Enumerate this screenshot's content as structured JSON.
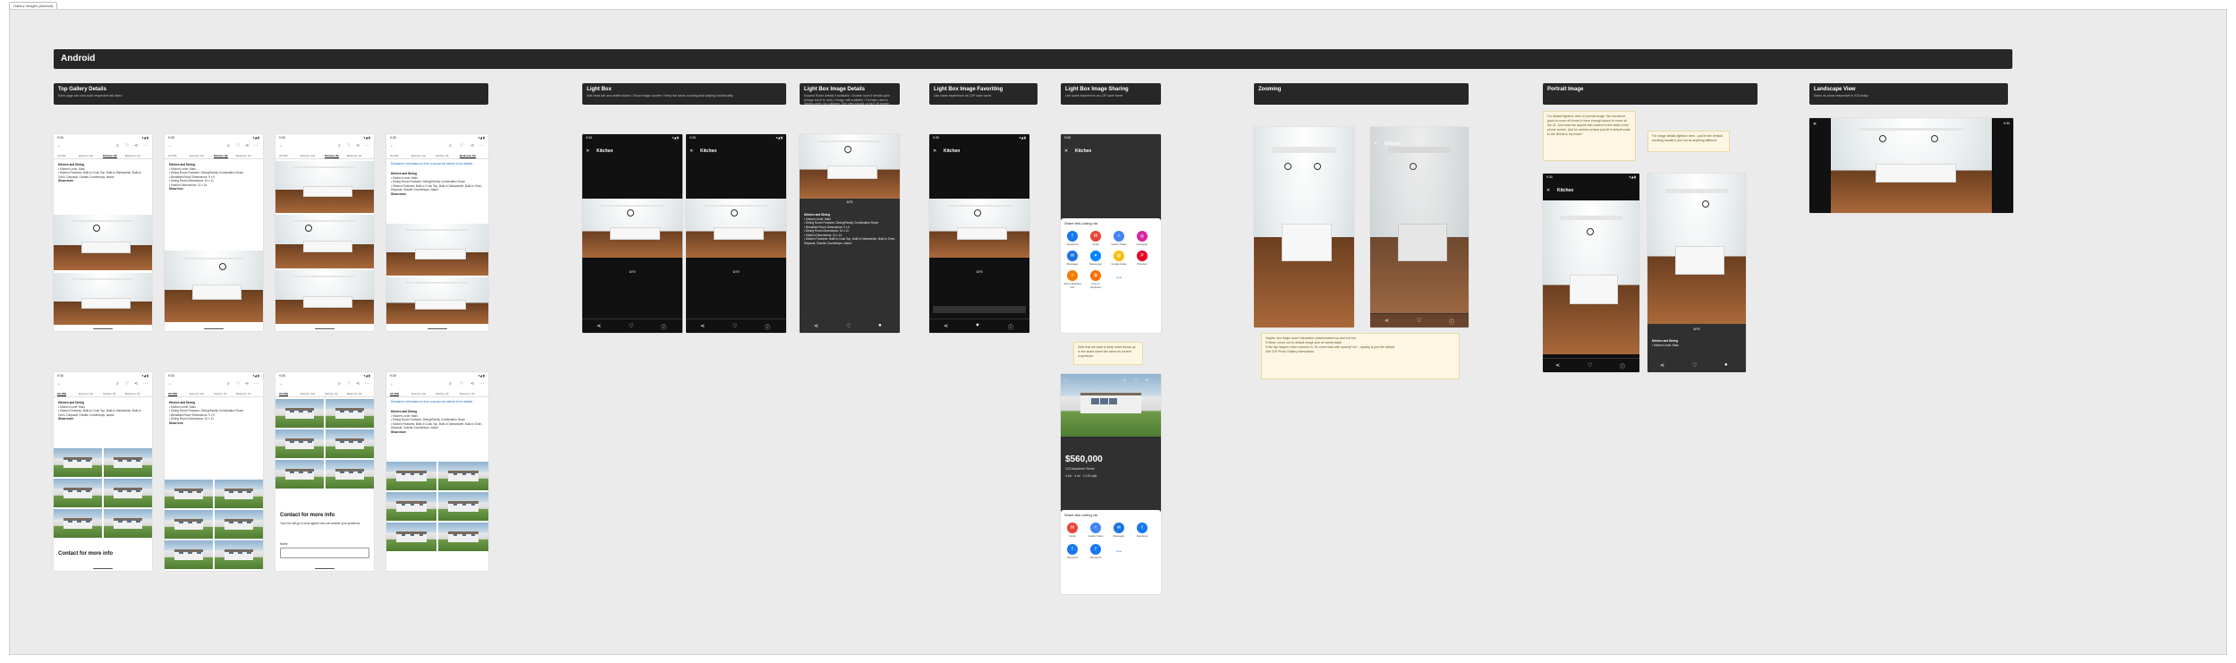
{
  "tab_chip": "Gallery Images (Android)",
  "banner": "Android",
  "sections": {
    "top_gallery": {
      "title": "Top Gallery Details",
      "desc": "Each page can hold each respective tab listed"
    },
    "light_box": {
      "title": "Light Box",
      "desc": "Add heart tab and delete button / Show image counter / Keep the same zooming and swiping functionality"
    },
    "lb_details": {
      "title": "Light Box Image Details",
      "desc": "Expand Room details if available / Enable room if details open (image scroll to next) / Image still available / Full tabs view to always open, No collapse. Text view should scroll if off screen"
    },
    "lb_fav": {
      "title": "Light Box Image Favoriting",
      "desc": "Use same experience as LDP save home"
    },
    "lb_share": {
      "title": "Light Box Image Sharing",
      "desc": "Use same experience as LDP save home"
    },
    "zooming": {
      "title": "Zooming",
      "desc": ""
    },
    "portrait": {
      "title": "Portrait Image",
      "desc": ""
    },
    "landscape": {
      "title": "Landscape View",
      "desc": "Same as photo respective in iOS today"
    }
  },
  "phone": {
    "time": "9:30",
    "signal": "▾◢ ▮",
    "tabs": [
      "All (58)",
      "Exterior (11)",
      "Kitchen (6)",
      "Bedroom (6)"
    ],
    "kitchen_heading": "Kitchen and Dining",
    "kitchen_items": [
      "• Kitchen Level: Main",
      "• Dining Room Features: Dining/Family Combination Room",
      "• Breakfast Room Dimensions: 9 x 9",
      "• Dining Room Dimensions: 10 x 11",
      "• Kitchen Dimensions: 11 x 14",
      "• Kitchen Features: Built-In Cook Top, Built-In Dishwasher, Built-In Oven, Disposal, Granite Countertops, Island"
    ],
    "show_more": "Show more",
    "show_less": "Show less",
    "room_title": "Kitchen",
    "counter": "6/79",
    "contact": "Contact for more info",
    "contact_desc": "Your info will go to local agents who can answer your questions.",
    "name_label": "Name",
    "disclaimer_link": "Disclaimer: Information is from a source we believe to be reliable."
  },
  "share": {
    "title": "Share this Listing via",
    "apps": [
      {
        "name": "Facebook",
        "color": "#1877f2",
        "glyph": "f"
      },
      {
        "name": "Gmail",
        "color": "#ea4335",
        "glyph": "M"
      },
      {
        "name": "Nearby Share",
        "color": "#4285f4",
        "glyph": "≈"
      },
      {
        "name": "Instagram",
        "color": "#d6249f",
        "glyph": "◎"
      },
      {
        "name": "Messages",
        "color": "#1a73e8",
        "glyph": "✉"
      },
      {
        "name": "Messenger",
        "color": "#0084ff",
        "glyph": "✦"
      },
      {
        "name": "Google Notes",
        "color": "#fbbc04",
        "glyph": "▤"
      },
      {
        "name": "Pinterest",
        "color": "#e60023",
        "glyph": "P"
      },
      {
        "name": "Add to Reading List",
        "color": "#f57c00",
        "glyph": "＋"
      },
      {
        "name": "Copy to Clipboard",
        "color": "#ff6d00",
        "glyph": "⧉"
      }
    ],
    "more": "more"
  },
  "listing": {
    "price": "$560,000",
    "address": "123 Anywhere Street",
    "meta": "4 bd · 3 ba · 2,100 sqft"
  },
  "notes": {
    "share_note": "Note that we want to keep what shows up in the share sheet the same as current experience",
    "zoom_note_1": "Maybe, two finger zoom interaction closes/makes top and bot bar",
    "zoom_note_2": "If these, zoom out to default image size rel center/state",
    "zoom_note_3": "If the tap happen when zoomed in, UI come back with opacity*<#> - opacity is just the default",
    "zoom_note_4": "See iOS Photo Gallery interactions",
    "portrait_note": "For default lightbox view of portrait image. We should be good to move all forms to have enough space to move all the UI. Just have the aspect ratio based on the width of the phone screen. And for ambien photos just let it default scale to the fit that is my make?",
    "portrait_note2": "For image details lightbox view - just let the vertical scrolling handle it and not do anything different."
  }
}
